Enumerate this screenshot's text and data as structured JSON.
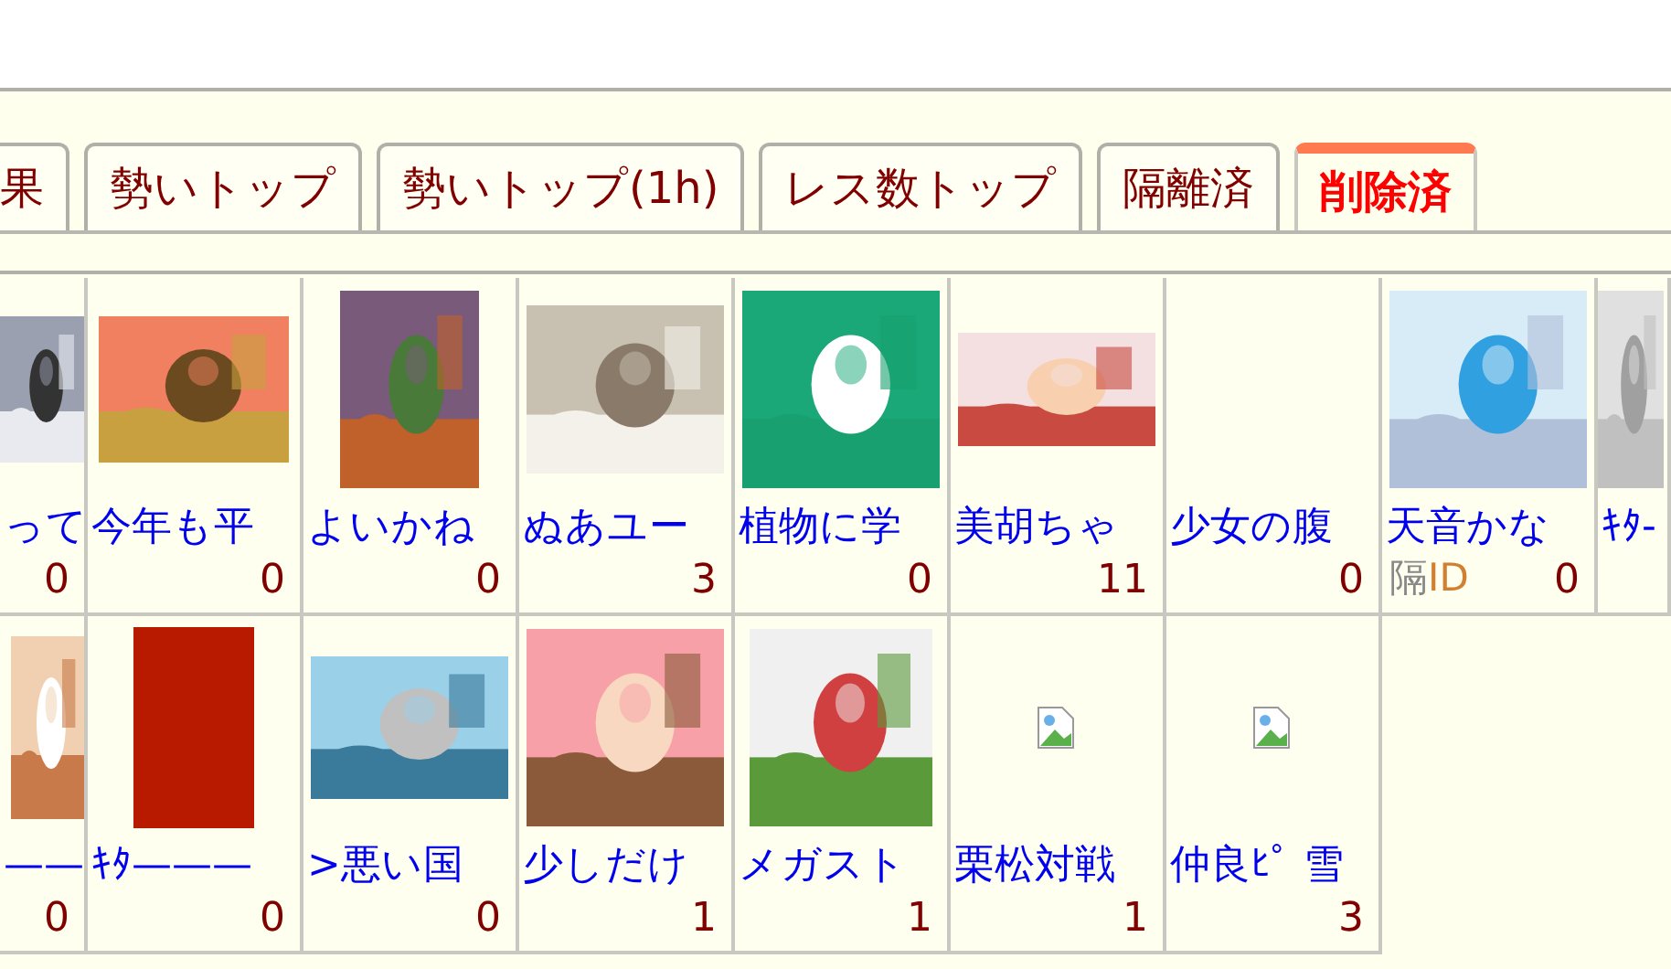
{
  "tabs": [
    {
      "label": "果",
      "selected": false
    },
    {
      "label": "勢いトップ",
      "selected": false
    },
    {
      "label": "勢いトップ(1h)",
      "selected": false
    },
    {
      "label": "レス数トップ",
      "selected": false
    },
    {
      "label": "隔離済",
      "selected": false
    },
    {
      "label": "削除済",
      "selected": true
    }
  ],
  "catalog": [
    [
      {
        "kind": "picture",
        "title": "って",
        "count": "0"
      },
      {
        "kind": "picture",
        "title": "今年も平",
        "count": "0"
      },
      {
        "kind": "picture",
        "title": "よいかね",
        "count": "0"
      },
      {
        "kind": "picture",
        "title": "ぬあユー",
        "count": "3"
      },
      {
        "kind": "picture",
        "title": "植物に学",
        "count": "0"
      },
      {
        "kind": "picture",
        "title": "美胡ちゃ",
        "count": "11"
      },
      {
        "kind": "textonly",
        "title": "少女の腹",
        "count": "0"
      },
      {
        "kind": "picture",
        "title": "天音かな",
        "count": "0",
        "tags": [
          {
            "text": "隔",
            "kind": "isolated"
          },
          {
            "text": "ID",
            "kind": "id"
          }
        ]
      },
      {
        "kind": "picture",
        "title": "ｷﾀ-"
      }
    ],
    [
      {
        "kind": "picture",
        "title": "——",
        "count": "0"
      },
      {
        "kind": "picture",
        "title": "ｷﾀ———",
        "count": "0"
      },
      {
        "kind": "picture",
        "title": ">悪い国",
        "count": "0"
      },
      {
        "kind": "picture",
        "title": "少しだけ",
        "count": "1"
      },
      {
        "kind": "picture",
        "title": "メガスト",
        "count": "1"
      },
      {
        "kind": "broken",
        "title": "栗松対戦",
        "count": "1"
      },
      {
        "kind": "broken",
        "title": "仲良ﾋﾟ 雪",
        "count": "3"
      }
    ]
  ]
}
